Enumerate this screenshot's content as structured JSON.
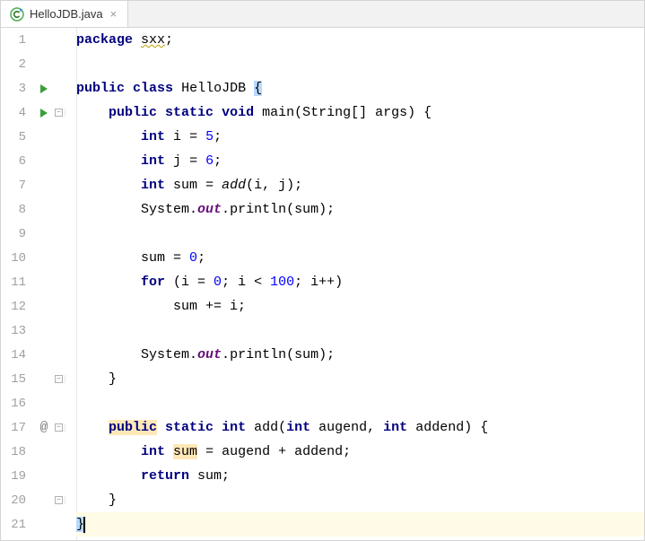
{
  "tab": {
    "filename": "HelloJDB.java",
    "close_glyph": "×"
  },
  "gutter": {
    "lines": [
      "1",
      "2",
      "3",
      "4",
      "5",
      "6",
      "7",
      "8",
      "9",
      "10",
      "11",
      "12",
      "13",
      "14",
      "15",
      "16",
      "17",
      "18",
      "19",
      "20",
      "21"
    ],
    "at_glyph": "@"
  },
  "code": {
    "l1": {
      "kw_package": "package",
      "pkg": "sxx",
      "semi": ";"
    },
    "l3": {
      "kw_public": "public",
      "kw_class": "class",
      "name": "HelloJDB",
      "brace": "{"
    },
    "l4": {
      "kw_public": "public",
      "kw_static": "static",
      "kw_void": "void",
      "name": "main",
      "args": "(String[] args)",
      "brace": "{"
    },
    "l5": {
      "kw_int": "int",
      "var": "i",
      "eq": " = ",
      "val": "5",
      "semi": ";"
    },
    "l6": {
      "kw_int": "int",
      "var": "j",
      "eq": " = ",
      "val": "6",
      "semi": ";"
    },
    "l7": {
      "kw_int": "int",
      "var": "sum",
      "eq": " = ",
      "call": "add",
      "args": "(i, j)",
      "semi": ";"
    },
    "l8": {
      "sys": "System.",
      "out": "out",
      "dot": ".",
      "call": "println(sum);"
    },
    "l10": {
      "var": "sum",
      "rest": " = ",
      "val": "0",
      "semi": ";"
    },
    "l11": {
      "kw_for": "for",
      "open": " (i = ",
      "z": "0",
      "mid": "; i < ",
      "h": "100",
      "end": "; i++)"
    },
    "l12": {
      "txt": "sum += i;"
    },
    "l14": {
      "sys": "System.",
      "out": "out",
      "dot": ".",
      "call": "println(sum);"
    },
    "l15": {
      "brace": "}"
    },
    "l17": {
      "kw_public": "public",
      "kw_static": "static",
      "kw_int": "int",
      "name": "add",
      "args": "(",
      "kw_int2": "int",
      "arg1": " augend, ",
      "kw_int3": "int",
      "arg2": " addend)",
      "brace": " {"
    },
    "l18": {
      "kw_int": "int",
      "var": "sum",
      "rest": " = augend + addend;"
    },
    "l19": {
      "kw_return": "return",
      "rest": " sum;"
    },
    "l20": {
      "brace": "}"
    },
    "l21": {
      "brace": "}"
    }
  }
}
